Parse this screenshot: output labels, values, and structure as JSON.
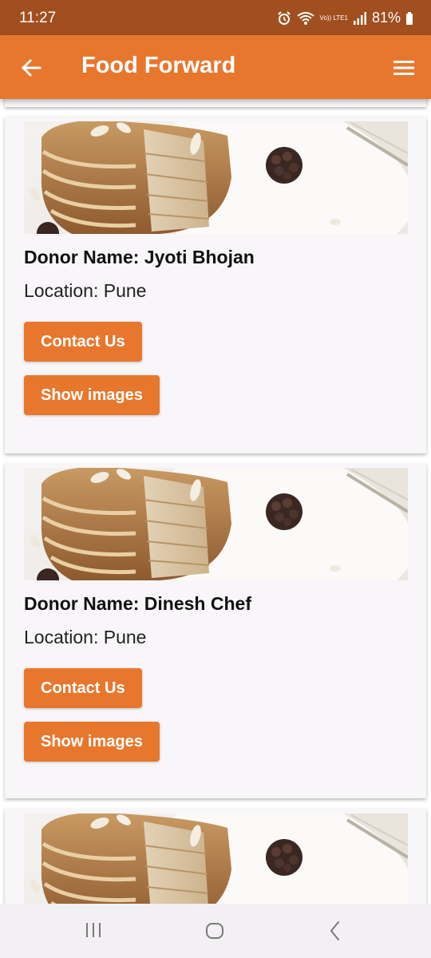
{
  "status_bar": {
    "time": "11:27",
    "battery": "81%",
    "volte": "Vo)) LTE1",
    "icons": [
      "alarm-icon",
      "wifi-icon",
      "volte-icon",
      "signal-icon",
      "battery-icon"
    ]
  },
  "app_bar": {
    "title": "Food Forward",
    "back_icon": "arrow-left-icon",
    "menu_icon": "hamburger-menu-icon",
    "color": "#e8772e"
  },
  "donors": [
    {
      "name": "Donor Name: Jyoti Bhojan",
      "location": "Location: Pune",
      "contact_label": "Contact Us",
      "images_label": "Show images",
      "image": "pancake-stack-photo"
    },
    {
      "name": "Donor Name: Dinesh Chef",
      "location": "Location: Pune",
      "contact_label": "Contact Us",
      "images_label": "Show images",
      "image": "pancake-stack-photo"
    },
    {
      "image": "pancake-stack-photo"
    }
  ],
  "nav_bar": {
    "icons": [
      "recent-apps-icon",
      "home-icon",
      "back-icon"
    ]
  },
  "colors": {
    "primary": "#e8772e",
    "status_bar": "#a14f1f",
    "card_background": "#f8f6f8"
  }
}
